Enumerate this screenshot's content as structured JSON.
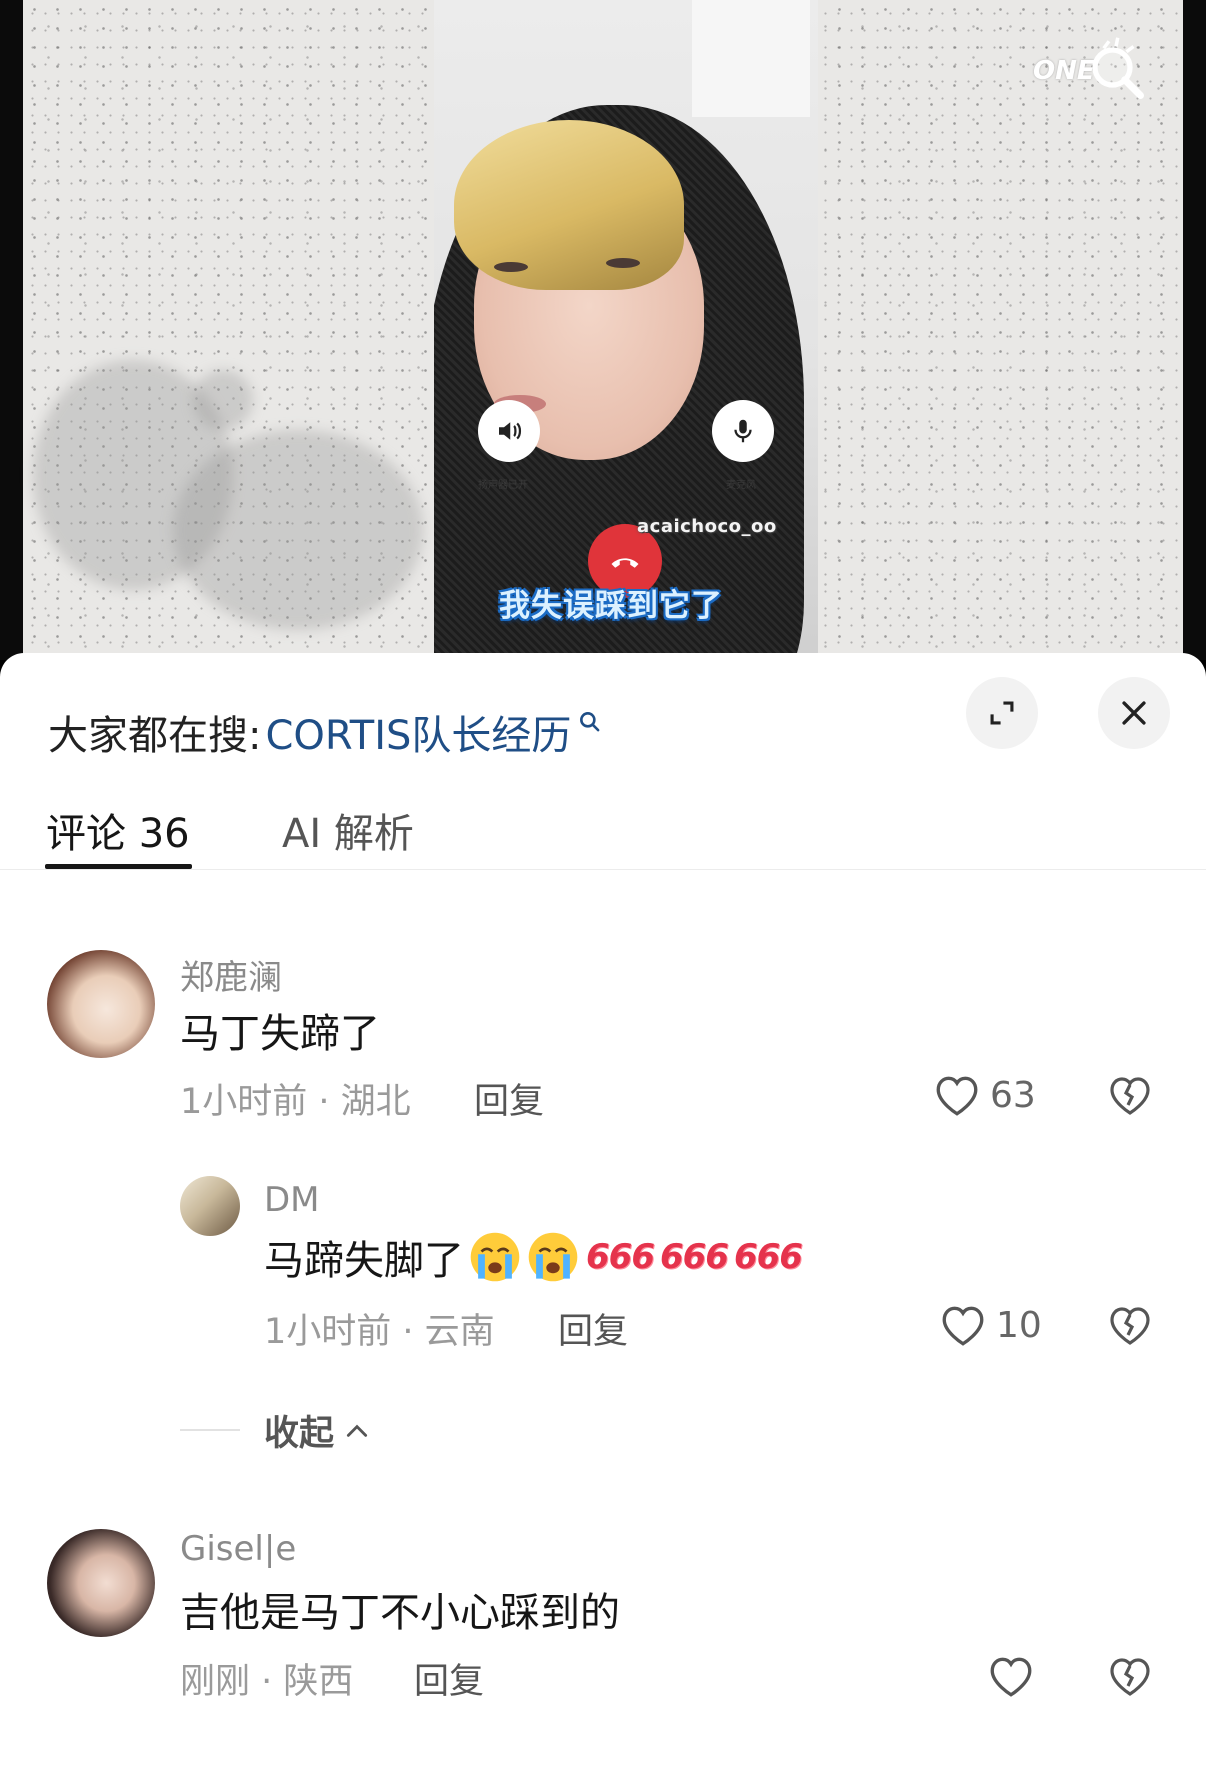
{
  "video": {
    "speaker_label": "扬声器已开",
    "mic_label": "麦克风",
    "watermark_id": "acaichoco_oo",
    "subtitle": "我失误踩到它了",
    "brand_text": "ONE"
  },
  "sheet": {
    "search_prefix": "大家都在搜:",
    "search_term": "CORTIS队长经历",
    "tabs": [
      {
        "label": "评论 36",
        "active": true
      },
      {
        "label": "AI 解析",
        "active": false
      }
    ],
    "collapse_label": "收起"
  },
  "comments": [
    {
      "username": "郑鹿澜",
      "text": "马丁失蹄了",
      "meta": "1小时前 · 湖北",
      "reply": "回复",
      "likes": "63"
    },
    {
      "username": "DM",
      "text": "马蹄失脚了",
      "emoji_six": [
        "666",
        "666",
        "666"
      ],
      "meta": "1小时前 · 云南",
      "reply": "回复",
      "likes": "10"
    },
    {
      "username": "Gisel|e",
      "text": "吉他是马丁不小心踩到的",
      "meta": "刚刚 · 陕西",
      "reply": "回复",
      "likes": ""
    }
  ],
  "colors": {
    "search_term": "#1f4e86",
    "hangup": "#e0343a",
    "emoji_six": "#e5334c"
  }
}
